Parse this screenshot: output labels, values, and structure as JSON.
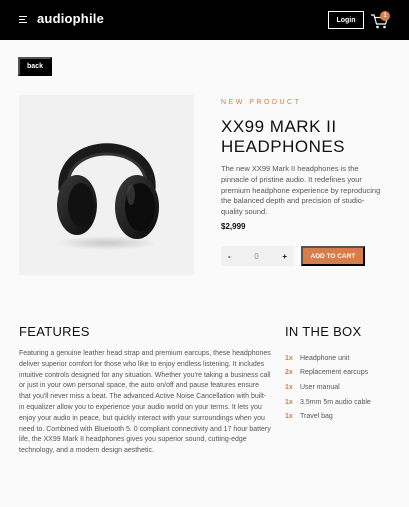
{
  "header": {
    "brand": "audiophile",
    "login_label": "Login",
    "cart_count": "1",
    "menu_icon": "hamburger-icon",
    "cart_icon": "cart-icon"
  },
  "nav": {
    "back_label": "back"
  },
  "product": {
    "overline": "NEW PRODUCT",
    "name": "XX99 MARK II HEADPHONES",
    "description": "The new XX99 Mark II headphones is the pinnacle of pristine audio. It redefines your premium headphone experience by reproducing the balanced depth and precision of studio-quality sound.",
    "price": "$2,999",
    "quantity": {
      "minus": "-",
      "value": "0",
      "plus": "+"
    },
    "add_to_cart_label": "ADD TO CART"
  },
  "features": {
    "title": "FEATURES",
    "body": "Featuring a genuine leather head strap and premium earcups, these headphones deliver superior comfort for those who like to enjoy endless listening. It includes intuitive controls designed for any situation. Whether you're taking a business call or just in your own personal space, the auto on/off and pause features ensure that you'll never miss a beat. The advanced Active Noise Cancellation with built-in equalizer allow you to experience your audio world on your terms. It lets you enjoy your audio in peace, but quickly interact with your surroundings when you need to. Combined with Bluetooth 5. 0 compliant connectivity and 17 hour battery life, the XX99 Mark II headphones gives you superior sound, cutting-edge technology, and a modern design aesthetic."
  },
  "in_the_box": {
    "title": "IN THE BOX",
    "items": [
      {
        "qty": "1x",
        "name": "Headphone unit"
      },
      {
        "qty": "2x",
        "name": "Replacement earcups"
      },
      {
        "qty": "1x",
        "name": "User manual"
      },
      {
        "qty": "1x",
        "name": "3.5mm 5m audio cable"
      },
      {
        "qty": "1x",
        "name": "Travel bag"
      }
    ]
  },
  "colors": {
    "accent": "#d87d4a",
    "header_bg": "#000000",
    "page_bg": "#fafafa",
    "image_bg": "#f1f1f1"
  }
}
